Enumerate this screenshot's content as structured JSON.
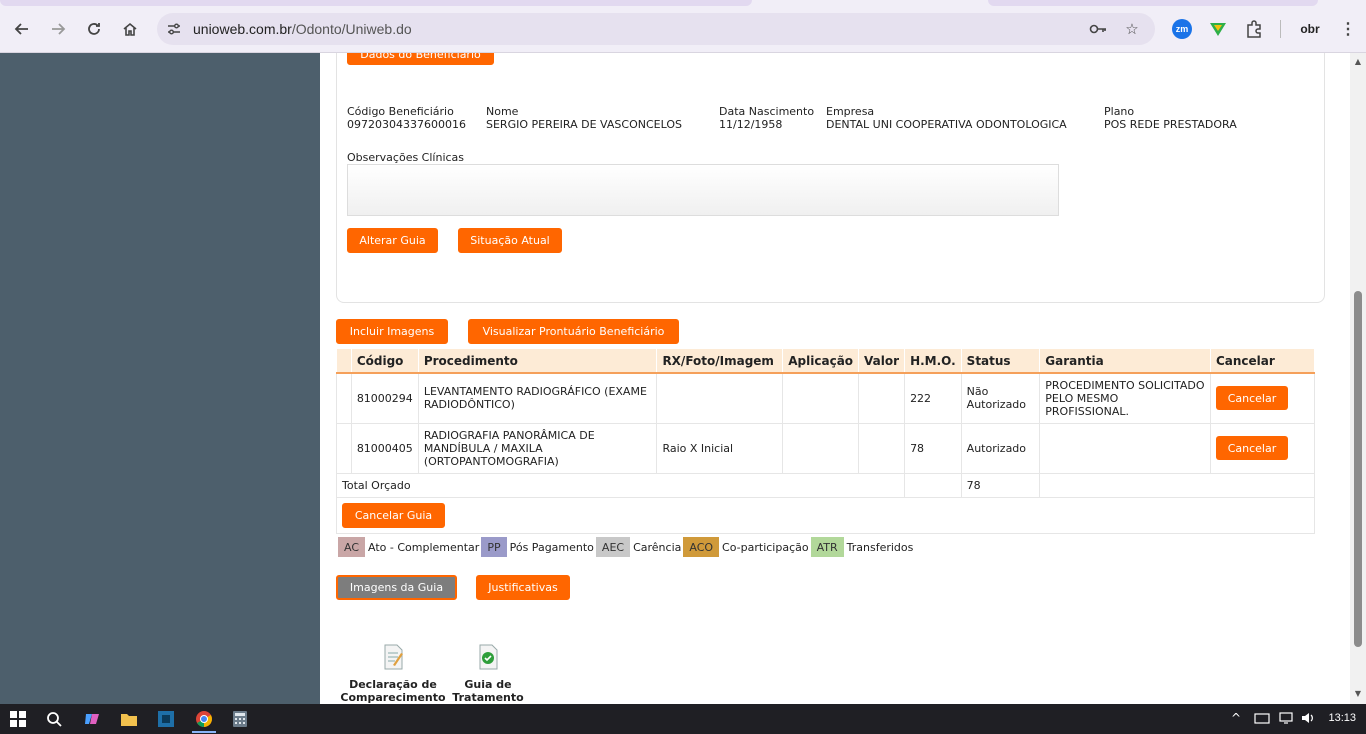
{
  "browser": {
    "url_host": "unioweb.com.br",
    "url_path": "/Odonto/Uniweb.do",
    "ext_zm_label": "zm",
    "ext_obr_label": "obr"
  },
  "page": {
    "top_button_label": "Dados do Beneficiário",
    "beneficiary": {
      "code_label": "Código Beneficiário",
      "code_value": "09720304337600016",
      "name_label": "Nome",
      "name_value": "SERGIO PEREIRA DE VASCONCELOS",
      "birth_label": "Data Nascimento",
      "birth_value": "11/12/1958",
      "company_label": "Empresa",
      "company_value": "DENTAL UNI COOPERATIVA ODONTOLOGICA",
      "plan_label": "Plano",
      "plan_value": "POS REDE PRESTADORA"
    },
    "obs_label": "Observações Clínicas",
    "obs_value": "",
    "alterar_guia_label": "Alterar Guia",
    "situacao_atual_label": "Situação Atual",
    "incluir_imagens_label": "Incluir Imagens",
    "visualizar_prontuario_label": "Visualizar Prontuário Beneficiário",
    "table": {
      "headers": [
        "Código",
        "Procedimento",
        "RX/Foto/Imagem",
        "Aplicação",
        "Valor",
        "H.M.O.",
        "Status",
        "Garantia",
        "Cancelar"
      ],
      "rows": [
        {
          "codigo": "81000294",
          "procedimento": "LEVANTAMENTO RADIOGRÁFICO (EXAME RADIODÔNTICO)",
          "rx": "",
          "aplicacao": "",
          "valor": "",
          "hmo": "222",
          "status": "Não Autorizado",
          "garantia": "PROCEDIMENTO SOLICITADO PELO MESMO PROFISSIONAL.",
          "cancel_label": "Cancelar"
        },
        {
          "codigo": "81000405",
          "procedimento": "RADIOGRAFIA PANORÂMICA DE MANDÍBULA / MAXILA (ORTOPANTOMOGRAFIA)",
          "rx": "Raio X Inicial",
          "aplicacao": "",
          "valor": "",
          "hmo": "78",
          "status": "Autorizado",
          "garantia": "",
          "cancel_label": "Cancelar"
        }
      ],
      "total_label": "Total Orçado",
      "total_hmo": "78",
      "cancelar_guia_label": "Cancelar Guia"
    },
    "legend": [
      {
        "code": "AC",
        "label": "Ato - Complementar",
        "color": "#c9a6a6"
      },
      {
        "code": "PP",
        "label": "Pós Pagamento",
        "color": "#9a9ac9"
      },
      {
        "code": "AEC",
        "label": "Carência",
        "color": "#c8c8c8"
      },
      {
        "code": "ACO",
        "label": "Co-participação",
        "color": "#d09a3a"
      },
      {
        "code": "ATR",
        "label": "Transferidos",
        "color": "#b2d89a"
      }
    ],
    "imagens_guia_label": "Imagens da Guia",
    "justificativas_label": "Justificativas",
    "docs": [
      {
        "line1": "Declaração de",
        "line2": "Comparecimento",
        "icon": "document-icon"
      },
      {
        "line1": "Guia de",
        "line2": "Tratamento",
        "icon": "check-document-icon"
      }
    ]
  },
  "taskbar": {
    "time": "13:13"
  }
}
